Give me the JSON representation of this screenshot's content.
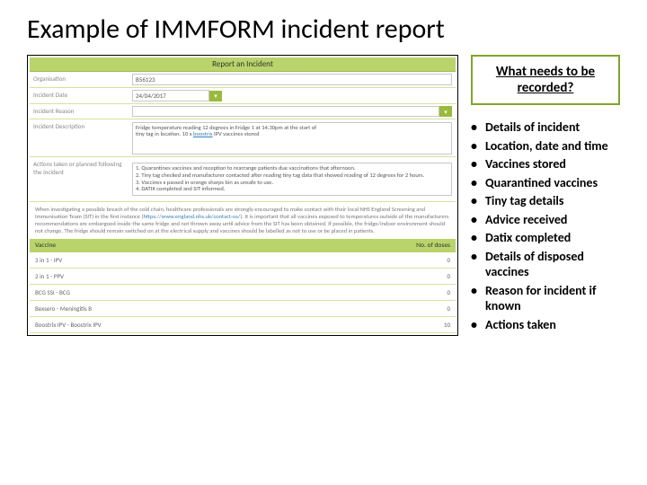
{
  "slide": {
    "title": "Example of IMMFORM incident report"
  },
  "form": {
    "banner": "Report an Incident",
    "labels": {
      "organisation": "Organisation",
      "incident_date": "Incident Date",
      "incident_reason": "Incident Reason",
      "incident_description": "Incident Description",
      "actions": "Actions taken or planned following the incident"
    },
    "values": {
      "organisation": "B56123",
      "incident_date": "24/04/2017",
      "incident_description_1": "Fridge temperature reading 12 degrees in Fridge 1 at 14.30pm at the start of",
      "incident_description_2": "tiny tag in location. 10 x ",
      "incident_description_link": "boostrix",
      "incident_description_3": " IPV vaccines stored",
      "actions_text": "1. Quarantines vaccines and reception to rearrange patients due vaccinations that afternoon.\n2. Tiny tag checked and manufacturer contacted after reading tiny tag data that showed reading of 12 degrees for 2 hours.\n3. Vaccines x passed in orange sharps bin as unsafe to use.\n4. DATIX completed and SIT informed."
    },
    "note_1": "When investigating a possible breach of the cold chain, healthcare professionals are strongly encouraged to make contact with their local NHS England Screening and Immunisation Team (SIT) in the first instance (",
    "note_link": "https://www.england.nhs.uk/contact-us/",
    "note_2": "). It is important that all vaccines exposed to temperatures outside of the manufacturers recommendations are embargoed inside the same fridge and not thrown away until advice from the SIT has been obtained. If possible, the fridge/indoor environment should not change. The fridge should remain switched on at the electrical supply and vaccines should be labelled as not to use or be placed in patients.",
    "table": {
      "col_vaccine": "Vaccine",
      "col_doses": "No. of doses",
      "rows": [
        {
          "v": "3 in 1 - IPV",
          "d": "0"
        },
        {
          "v": "2 in 1 - PPV",
          "d": "0"
        },
        {
          "v": "BCG SSI - BCG",
          "d": "0"
        },
        {
          "v": "Bexsero - Meningitis B",
          "d": "0"
        },
        {
          "v": "Boostrix IPV - Boostrix IPV",
          "d": "10"
        }
      ]
    }
  },
  "info": {
    "box_title": "What needs to be recorded?",
    "bullets": [
      "Details of incident",
      "Location, date and time",
      "Vaccines stored",
      "Quarantined vaccines",
      "Tiny tag details",
      "Advice received",
      "Datix completed",
      "Details of disposed vaccines",
      "Reason for incident if known",
      "Actions taken"
    ]
  }
}
